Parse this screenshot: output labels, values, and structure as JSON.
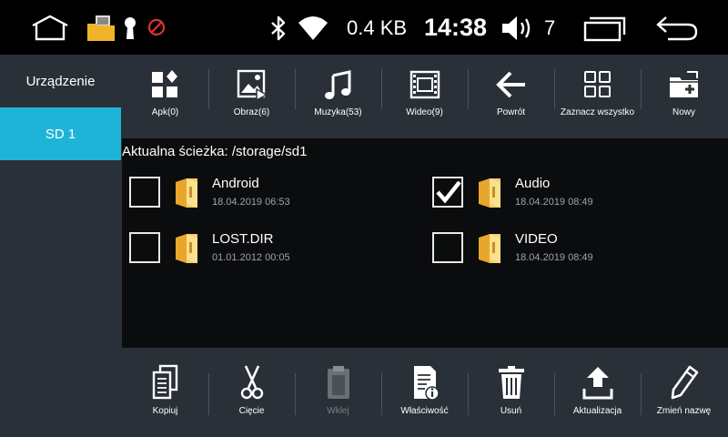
{
  "status_bar": {
    "net_speed": "0.4 KB",
    "time": "14:38",
    "volume_level": "7",
    "icons": [
      "home-icon",
      "folder-notification-icon",
      "keyhole-icon",
      "blocked-icon",
      "bluetooth-icon",
      "wifi-icon",
      "volume-icon",
      "recents-icon",
      "back-icon"
    ]
  },
  "sidebar": {
    "items": [
      {
        "label": "Urządzenie",
        "selected": false
      },
      {
        "label": "SD 1",
        "selected": true
      }
    ],
    "accent_color": "#1eb4d8"
  },
  "toolbar": {
    "buttons": [
      {
        "label": "Apk(0)",
        "icon": "apk-icon"
      },
      {
        "label": "Obraz(6)",
        "icon": "image-icon"
      },
      {
        "label": "Muzyka(53)",
        "icon": "music-icon"
      },
      {
        "label": "Wideo(9)",
        "icon": "video-icon"
      },
      {
        "label": "Powrót",
        "icon": "arrow-left-icon"
      },
      {
        "label": "Zaznacz wszystko",
        "icon": "grid-icon"
      },
      {
        "label": "Nowy",
        "icon": "new-folder-icon"
      }
    ]
  },
  "main": {
    "path": "Aktualna ścieżka: /storage/sd1",
    "files": [
      {
        "name": "Android",
        "date": "18.04.2019 06:53",
        "checked": false
      },
      {
        "name": "Audio",
        "date": "18.04.2019 08:49",
        "checked": true
      },
      {
        "name": "LOST.DIR",
        "date": "01.01.2012 00:05",
        "checked": false
      },
      {
        "name": "VIDEO",
        "date": "18.04.2019 08:49",
        "checked": false
      }
    ]
  },
  "bottombar": {
    "buttons": [
      {
        "label": "Kopiuj",
        "icon": "copy-icon",
        "enabled": true
      },
      {
        "label": "Cięcie",
        "icon": "scissors-icon",
        "enabled": true
      },
      {
        "label": "Wklej",
        "icon": "paste-icon",
        "enabled": false
      },
      {
        "label": "Właściwość",
        "icon": "properties-icon",
        "enabled": true
      },
      {
        "label": "Usuń",
        "icon": "trash-icon",
        "enabled": true
      },
      {
        "label": "Aktualizacja",
        "icon": "upload-icon",
        "enabled": true
      },
      {
        "label": "Zmień nazwę",
        "icon": "pencil-icon",
        "enabled": true
      }
    ]
  }
}
